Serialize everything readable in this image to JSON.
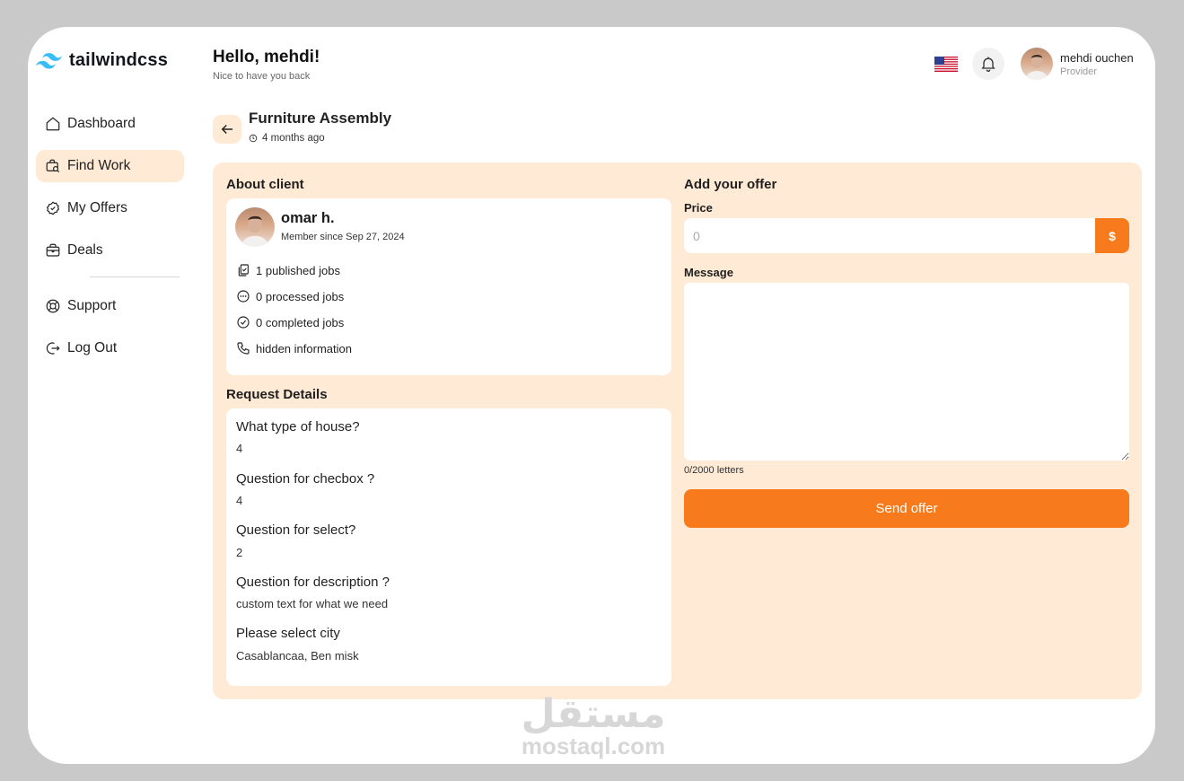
{
  "brand": {
    "name": "tailwindcss"
  },
  "sidebar": {
    "items": [
      {
        "label": "Dashboard",
        "icon": "home-icon",
        "active": false
      },
      {
        "label": "Find Work",
        "icon": "search-work-icon",
        "active": true
      },
      {
        "label": "My Offers",
        "icon": "offers-icon",
        "active": false
      },
      {
        "label": "Deals",
        "icon": "briefcase-icon",
        "active": false
      }
    ],
    "bottom_items": [
      {
        "label": "Support",
        "icon": "lifebuoy-icon"
      },
      {
        "label": "Log Out",
        "icon": "logout-icon"
      }
    ]
  },
  "header": {
    "greeting": "Hello, mehdi!",
    "subtitle": "Nice to have you back",
    "user": {
      "name": "mehdi ouchen",
      "role": "Provider"
    }
  },
  "job": {
    "title": "Furniture Assembly",
    "posted": "4 months ago"
  },
  "client": {
    "section_title": "About client",
    "name": "omar h.",
    "member_since": "Member since Sep 27, 2024",
    "stats": [
      "1 published jobs",
      "0 processed jobs",
      "0 completed jobs",
      "hidden information"
    ]
  },
  "request": {
    "section_title": "Request Details",
    "items": [
      {
        "question": "What type of house?",
        "answer": "4"
      },
      {
        "question": "Question for checbox ?",
        "answer": "4"
      },
      {
        "question": "Question for select?",
        "answer": "2"
      },
      {
        "question": "Question for description ?",
        "answer": "custom text for what we need"
      },
      {
        "question": "Please select city",
        "answer": "Casablancaa, Ben misk"
      }
    ]
  },
  "offer": {
    "section_title": "Add your offer",
    "price_label": "Price",
    "price_placeholder": "0",
    "currency": "$",
    "message_label": "Message",
    "counter": "0/2000 letters",
    "send_label": "Send offer"
  },
  "watermark": {
    "arabic": "مستقل",
    "latin": "mostaql.com"
  },
  "colors": {
    "accent": "#f77b1c",
    "panel": "#ffead5",
    "background": "#c9c9c9"
  }
}
